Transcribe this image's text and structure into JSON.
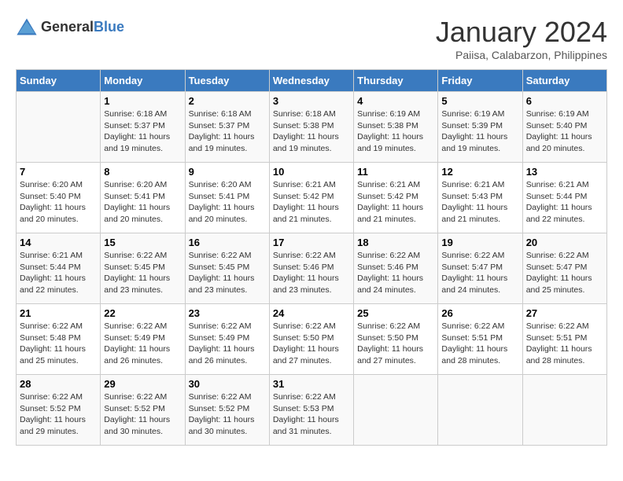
{
  "logo": {
    "general": "General",
    "blue": "Blue"
  },
  "title": "January 2024",
  "subtitle": "Paiisa, Calabarzon, Philippines",
  "days_of_week": [
    "Sunday",
    "Monday",
    "Tuesday",
    "Wednesday",
    "Thursday",
    "Friday",
    "Saturday"
  ],
  "weeks": [
    [
      {
        "day": "",
        "info": ""
      },
      {
        "day": "1",
        "info": "Sunrise: 6:18 AM\nSunset: 5:37 PM\nDaylight: 11 hours\nand 19 minutes."
      },
      {
        "day": "2",
        "info": "Sunrise: 6:18 AM\nSunset: 5:37 PM\nDaylight: 11 hours\nand 19 minutes."
      },
      {
        "day": "3",
        "info": "Sunrise: 6:18 AM\nSunset: 5:38 PM\nDaylight: 11 hours\nand 19 minutes."
      },
      {
        "day": "4",
        "info": "Sunrise: 6:19 AM\nSunset: 5:38 PM\nDaylight: 11 hours\nand 19 minutes."
      },
      {
        "day": "5",
        "info": "Sunrise: 6:19 AM\nSunset: 5:39 PM\nDaylight: 11 hours\nand 19 minutes."
      },
      {
        "day": "6",
        "info": "Sunrise: 6:19 AM\nSunset: 5:40 PM\nDaylight: 11 hours\nand 20 minutes."
      }
    ],
    [
      {
        "day": "7",
        "info": "Sunrise: 6:20 AM\nSunset: 5:40 PM\nDaylight: 11 hours\nand 20 minutes."
      },
      {
        "day": "8",
        "info": "Sunrise: 6:20 AM\nSunset: 5:41 PM\nDaylight: 11 hours\nand 20 minutes."
      },
      {
        "day": "9",
        "info": "Sunrise: 6:20 AM\nSunset: 5:41 PM\nDaylight: 11 hours\nand 20 minutes."
      },
      {
        "day": "10",
        "info": "Sunrise: 6:21 AM\nSunset: 5:42 PM\nDaylight: 11 hours\nand 21 minutes."
      },
      {
        "day": "11",
        "info": "Sunrise: 6:21 AM\nSunset: 5:42 PM\nDaylight: 11 hours\nand 21 minutes."
      },
      {
        "day": "12",
        "info": "Sunrise: 6:21 AM\nSunset: 5:43 PM\nDaylight: 11 hours\nand 21 minutes."
      },
      {
        "day": "13",
        "info": "Sunrise: 6:21 AM\nSunset: 5:44 PM\nDaylight: 11 hours\nand 22 minutes."
      }
    ],
    [
      {
        "day": "14",
        "info": "Sunrise: 6:21 AM\nSunset: 5:44 PM\nDaylight: 11 hours\nand 22 minutes."
      },
      {
        "day": "15",
        "info": "Sunrise: 6:22 AM\nSunset: 5:45 PM\nDaylight: 11 hours\nand 23 minutes."
      },
      {
        "day": "16",
        "info": "Sunrise: 6:22 AM\nSunset: 5:45 PM\nDaylight: 11 hours\nand 23 minutes."
      },
      {
        "day": "17",
        "info": "Sunrise: 6:22 AM\nSunset: 5:46 PM\nDaylight: 11 hours\nand 23 minutes."
      },
      {
        "day": "18",
        "info": "Sunrise: 6:22 AM\nSunset: 5:46 PM\nDaylight: 11 hours\nand 24 minutes."
      },
      {
        "day": "19",
        "info": "Sunrise: 6:22 AM\nSunset: 5:47 PM\nDaylight: 11 hours\nand 24 minutes."
      },
      {
        "day": "20",
        "info": "Sunrise: 6:22 AM\nSunset: 5:47 PM\nDaylight: 11 hours\nand 25 minutes."
      }
    ],
    [
      {
        "day": "21",
        "info": "Sunrise: 6:22 AM\nSunset: 5:48 PM\nDaylight: 11 hours\nand 25 minutes."
      },
      {
        "day": "22",
        "info": "Sunrise: 6:22 AM\nSunset: 5:49 PM\nDaylight: 11 hours\nand 26 minutes."
      },
      {
        "day": "23",
        "info": "Sunrise: 6:22 AM\nSunset: 5:49 PM\nDaylight: 11 hours\nand 26 minutes."
      },
      {
        "day": "24",
        "info": "Sunrise: 6:22 AM\nSunset: 5:50 PM\nDaylight: 11 hours\nand 27 minutes."
      },
      {
        "day": "25",
        "info": "Sunrise: 6:22 AM\nSunset: 5:50 PM\nDaylight: 11 hours\nand 27 minutes."
      },
      {
        "day": "26",
        "info": "Sunrise: 6:22 AM\nSunset: 5:51 PM\nDaylight: 11 hours\nand 28 minutes."
      },
      {
        "day": "27",
        "info": "Sunrise: 6:22 AM\nSunset: 5:51 PM\nDaylight: 11 hours\nand 28 minutes."
      }
    ],
    [
      {
        "day": "28",
        "info": "Sunrise: 6:22 AM\nSunset: 5:52 PM\nDaylight: 11 hours\nand 29 minutes."
      },
      {
        "day": "29",
        "info": "Sunrise: 6:22 AM\nSunset: 5:52 PM\nDaylight: 11 hours\nand 30 minutes."
      },
      {
        "day": "30",
        "info": "Sunrise: 6:22 AM\nSunset: 5:52 PM\nDaylight: 11 hours\nand 30 minutes."
      },
      {
        "day": "31",
        "info": "Sunrise: 6:22 AM\nSunset: 5:53 PM\nDaylight: 11 hours\nand 31 minutes."
      },
      {
        "day": "",
        "info": ""
      },
      {
        "day": "",
        "info": ""
      },
      {
        "day": "",
        "info": ""
      }
    ]
  ]
}
